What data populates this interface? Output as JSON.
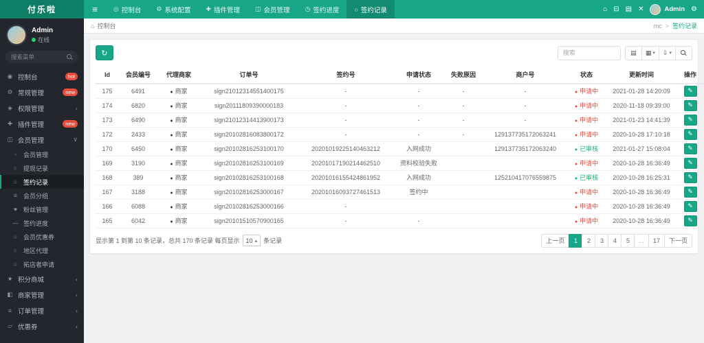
{
  "colors": {
    "topbar": "#18a689",
    "topbar_dark": "#128b72",
    "logo_bg": "#0f7e66",
    "sidebar_bg": "#23262d",
    "badge_red": "#e74c3c",
    "status_pending": "#e74c3c",
    "status_approved": "#18b573",
    "accent": "#18a689"
  },
  "topbar": {
    "logo": "付乐啦",
    "nav": [
      {
        "label": "控制台",
        "icon": "dashboard-icon",
        "active": false
      },
      {
        "label": "系统配置",
        "icon": "gear-icon",
        "active": false
      },
      {
        "label": "插件管理",
        "icon": "plugin-icon",
        "active": false
      },
      {
        "label": "会员管理",
        "icon": "users-icon",
        "active": false
      },
      {
        "label": "签约进度",
        "icon": "progress-icon",
        "active": false
      },
      {
        "label": "签约记录",
        "icon": "record-icon",
        "active": true
      }
    ],
    "action_icons": [
      "home-icon",
      "trash-icon",
      "file-icon",
      "close-icon"
    ],
    "username": "Admin"
  },
  "sidebar": {
    "user_name": "Admin",
    "user_status": "在线",
    "search_placeholder": "搜索菜单",
    "menu": [
      {
        "label": "控制台",
        "icon": "gauge-icon",
        "badge": "hot"
      },
      {
        "label": "常规管理",
        "icon": "gear-icon",
        "badge": "new"
      },
      {
        "label": "权限管理",
        "icon": "lock-icon",
        "chevron": "left"
      },
      {
        "label": "插件管理",
        "icon": "plugin-icon",
        "badge": "new"
      },
      {
        "label": "会员管理",
        "icon": "users-icon",
        "chevron": "down",
        "open": true,
        "children": [
          {
            "label": "会员管理",
            "icon": "user-icon",
            "active": false
          },
          {
            "label": "提现记录",
            "icon": "circle-icon",
            "active": false
          },
          {
            "label": "签约记录",
            "icon": "circle-icon",
            "active": true
          },
          {
            "label": "会员分组",
            "icon": "group-icon",
            "active": false
          },
          {
            "label": "粉丝管理",
            "icon": "fans-icon",
            "active": false
          },
          {
            "label": "签约进度",
            "icon": "minus-icon",
            "active": false
          },
          {
            "label": "会员优惠券",
            "icon": "circle-icon",
            "active": false
          },
          {
            "label": "地区代理",
            "icon": "circle-icon",
            "active": false
          },
          {
            "label": "拓店者申请",
            "icon": "circle-icon",
            "active": false
          }
        ]
      },
      {
        "label": "积分商城",
        "icon": "star-icon",
        "chevron": "left"
      },
      {
        "label": "商家管理",
        "icon": "shop-icon",
        "chevron": "left"
      },
      {
        "label": "订单管理",
        "icon": "order-icon",
        "chevron": "left"
      },
      {
        "label": "优惠券",
        "icon": "coupon-icon",
        "chevron": "left"
      }
    ]
  },
  "breadcrumb": {
    "label": "控制台",
    "path_parent": "mc",
    "separator": ">",
    "path_current": "签约记录"
  },
  "toolbar": {
    "search_placeholder": "搜索",
    "buttons": [
      {
        "icon": "list-icon",
        "caret": false
      },
      {
        "icon": "columns-icon",
        "caret": true
      },
      {
        "icon": "export-icon",
        "caret": true
      },
      {
        "icon": "search-icon",
        "caret": false
      }
    ]
  },
  "table": {
    "columns": [
      "Id",
      "会员编号",
      "代理商家",
      "订单号",
      "签约号",
      "申请状态",
      "失败原因",
      "商户号",
      "状态",
      "更新时间",
      "操作"
    ],
    "agent_label": "商家",
    "status_styles": {
      "申请中": "pending",
      "已审核": "approved"
    },
    "rows": [
      {
        "id": "175",
        "member": "6491",
        "order": "sign21012314551400175",
        "sign": "-",
        "apply": "-",
        "fail": "-",
        "merchant": "-",
        "status": "申请中",
        "time": "2021-01-28 14:20:09"
      },
      {
        "id": "174",
        "member": "6820",
        "order": "sign20111809390000183",
        "sign": "-",
        "apply": "-",
        "fail": "-",
        "merchant": "-",
        "status": "申请中",
        "time": "2020-11-18 09:39:00"
      },
      {
        "id": "173",
        "member": "6490",
        "order": "sign21012314413900173",
        "sign": "-",
        "apply": "-",
        "fail": "-",
        "merchant": "-",
        "status": "申请中",
        "time": "2021-01-23 14:41:39"
      },
      {
        "id": "172",
        "member": "2433",
        "order": "sign20102816083800172",
        "sign": "-",
        "apply": "-",
        "fail": "-",
        "merchant": "129137735172063241",
        "status": "申请中",
        "time": "2020-10-28 17:10:18"
      },
      {
        "id": "170",
        "member": "6450",
        "order": "sign20102816253100170",
        "sign": "20201019225140463212",
        "apply": "入网成功",
        "fail": "",
        "merchant": "129137735172063240",
        "status": "已审核",
        "time": "2021-01-27 15:08:04"
      },
      {
        "id": "169",
        "member": "3190",
        "order": "sign20102816253100169",
        "sign": "20201017190214462510",
        "apply": "资料校验失败",
        "fail": "",
        "merchant": "",
        "status": "申请中",
        "time": "2020-10-28 16:36:49"
      },
      {
        "id": "168",
        "member": "389",
        "order": "sign20102816253100168",
        "sign": "20201016155424861952",
        "apply": "入网成功",
        "fail": "",
        "merchant": "125210417076559875",
        "status": "已审核",
        "time": "2020-10-28 16:25:31"
      },
      {
        "id": "167",
        "member": "3188",
        "order": "sign20102816253000167",
        "sign": "20201016093727461513",
        "apply": "签约中",
        "fail": "",
        "merchant": "",
        "status": "申请中",
        "time": "2020-10-28 16:36:49"
      },
      {
        "id": "166",
        "member": "6088",
        "order": "sign20102816253000166",
        "sign": "-",
        "apply": "",
        "fail": "",
        "merchant": "",
        "status": "申请中",
        "time": "2020-10-28 16:36:49"
      },
      {
        "id": "165",
        "member": "6042",
        "order": "sign20101510570900165",
        "sign": "-",
        "apply": "-",
        "fail": "",
        "merchant": "",
        "status": "申请中",
        "time": "2020-10-28 16:36:49"
      }
    ]
  },
  "footer": {
    "summary": "显示第 1 到第 10 条记录，总共 170 条记录 每页显示",
    "page_size": "10",
    "summary_suffix": "条记录",
    "pagination": {
      "prev": "上一页",
      "pages": [
        "1",
        "2",
        "3",
        "4",
        "5",
        "...",
        "17"
      ],
      "active": "1",
      "next": "下一页"
    }
  }
}
